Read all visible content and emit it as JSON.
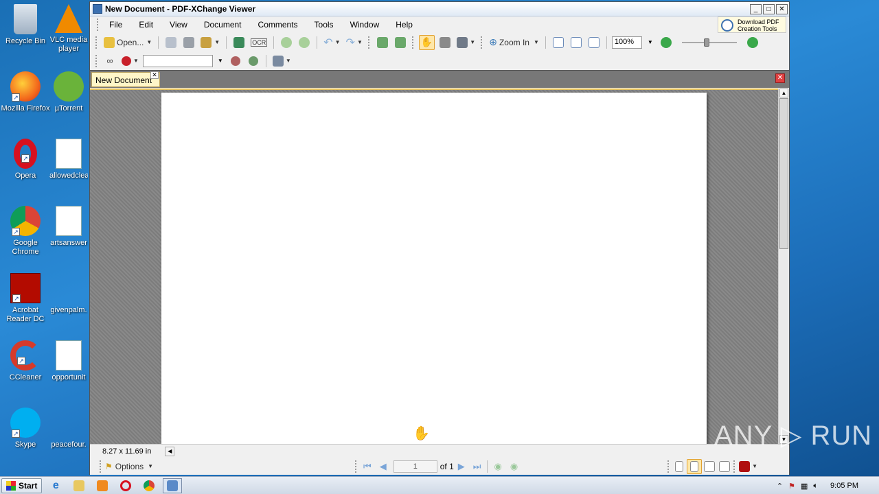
{
  "desktop": {
    "icons": [
      {
        "label": "Recycle Bin"
      },
      {
        "label": "VLC media player"
      },
      {
        "label": "Mozilla Firefox"
      },
      {
        "label": "µTorrent"
      },
      {
        "label": "Opera"
      },
      {
        "label": "allowedclea"
      },
      {
        "label": "Google Chrome"
      },
      {
        "label": "artsanswer"
      },
      {
        "label": "Acrobat Reader DC"
      },
      {
        "label": "givenpalm."
      },
      {
        "label": "CCleaner"
      },
      {
        "label": "opportunit"
      },
      {
        "label": "Skype"
      },
      {
        "label": "peacefour."
      }
    ]
  },
  "window": {
    "title": "New Document - PDF-XChange Viewer",
    "controls": {
      "minimize": "_",
      "maximize": "□",
      "close": "✕"
    }
  },
  "menu": {
    "items": [
      "File",
      "Edit",
      "View",
      "Document",
      "Comments",
      "Tools",
      "Window",
      "Help"
    ],
    "promo": "Download PDF Creation Tools"
  },
  "toolbar": {
    "open_label": "Open...",
    "ocr_label": "OCR",
    "zoom_in_label": "Zoom In",
    "zoom_value": "100%"
  },
  "tabs": {
    "active": "New Document",
    "close": "✕"
  },
  "status": {
    "page_size": "8.27 x 11.69 in"
  },
  "navigation": {
    "options_label": "Options",
    "current_page": "1",
    "total_pages": "of 1"
  },
  "taskbar": {
    "start_label": "Start",
    "clock": "9:05 PM"
  },
  "watermark": "ANY ▷ RUN"
}
